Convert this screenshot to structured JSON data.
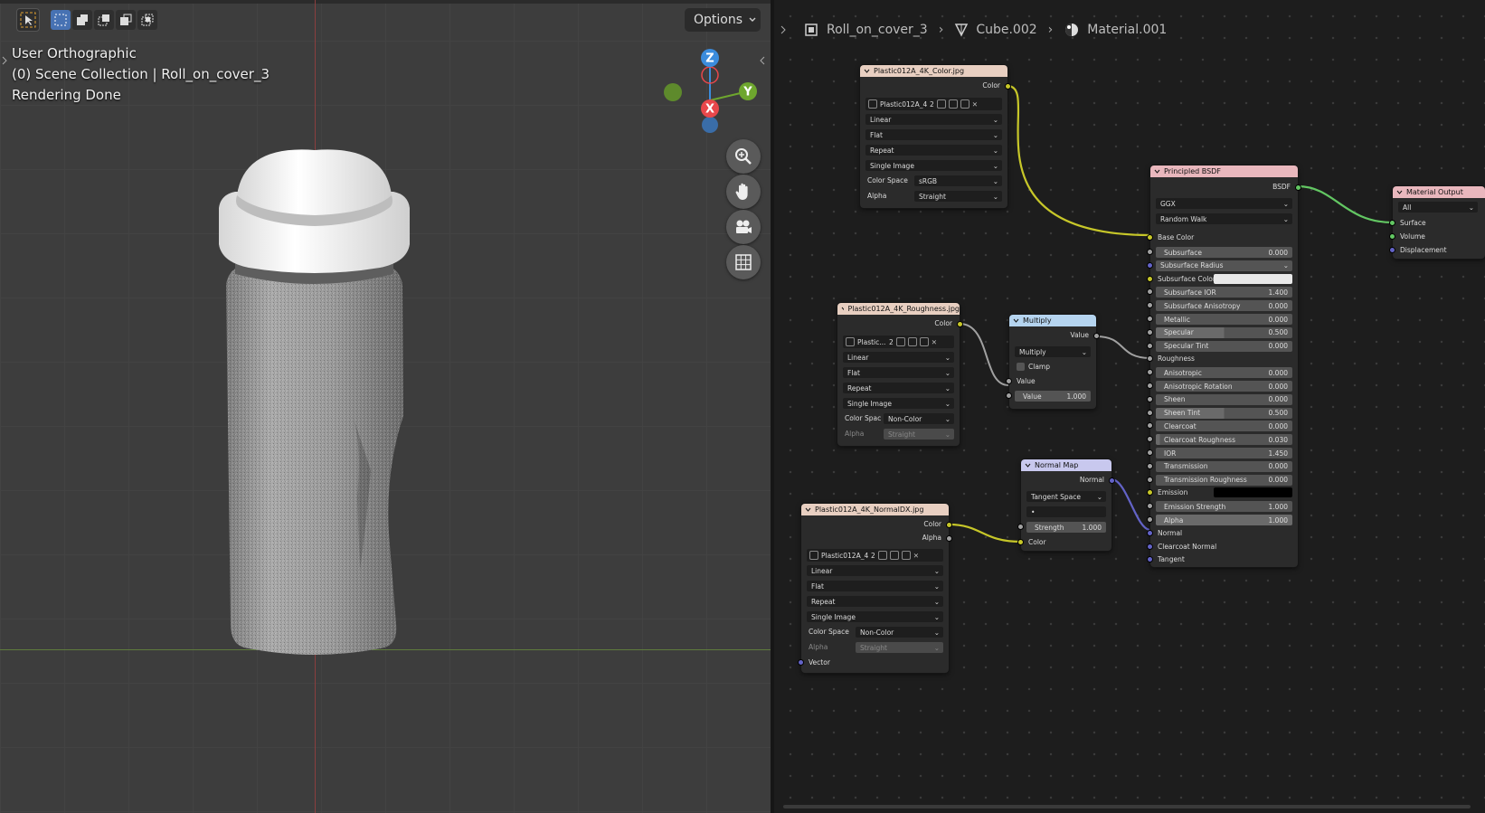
{
  "viewport": {
    "options_label": "Options",
    "overlay": {
      "view_name": "User Orthographic",
      "collection": "(0) Scene Collection | Roll_on_cover_3",
      "status": "Rendering Done"
    },
    "gizmo": {
      "z": "Z",
      "y": "Y",
      "x": "X"
    },
    "colors": {
      "bg": "#3d3d3d",
      "x_axis": "#e8474b",
      "y_axis": "#6ea62e",
      "z_axis": "#3b8cdc"
    }
  },
  "node_editor": {
    "breadcrumb": [
      "Roll_on_cover_3",
      "Cube.002",
      "Material.001"
    ],
    "nodes": {
      "color_tex": {
        "title": "Plastic012A_4K_Color.jpg",
        "output": "Color",
        "image_name": "Plastic012A_4...",
        "users": "2",
        "interpolation": "Linear",
        "projection": "Flat",
        "extension": "Repeat",
        "source": "Single Image",
        "colorspace_label": "Color Space",
        "colorspace": "sRGB",
        "alpha_label": "Alpha",
        "alpha": "Straight"
      },
      "rough_tex": {
        "title": "Plastic012A_4K_Roughness.jpg",
        "output": "Color",
        "image_name": "Plastic...",
        "users": "2",
        "interpolation": "Linear",
        "projection": "Flat",
        "extension": "Repeat",
        "source": "Single Image",
        "colorspace_label": "Color Spac",
        "colorspace": "Non-Color",
        "alpha_label": "Alpha",
        "alpha": "Straight"
      },
      "normal_tex": {
        "title": "Plastic012A_4K_NormalDX.jpg",
        "output_color": "Color",
        "output_alpha": "Alpha",
        "image_name": "Plastic012A_4...",
        "users": "2",
        "interpolation": "Linear",
        "projection": "Flat",
        "extension": "Repeat",
        "source": "Single Image",
        "colorspace_label": "Color Space",
        "colorspace": "Non-Color",
        "alpha_label": "Alpha",
        "alpha": "Straight",
        "vector_input": "Vector"
      },
      "multiply": {
        "title": "Multiply",
        "output": "Value",
        "operation": "Multiply",
        "clamp_label": "Clamp",
        "input1": "Value",
        "input2_label": "Value",
        "input2_value": "1.000"
      },
      "normal_map": {
        "title": "Normal Map",
        "output": "Normal",
        "space": "Tangent Space",
        "uv": "•",
        "strength_label": "Strength",
        "strength_value": "1.000",
        "color_input": "Color"
      },
      "bsdf": {
        "title": "Principled BSDF",
        "output": "BSDF",
        "distribution": "GGX",
        "subsurface_method": "Random Walk",
        "base_color": "Base Color",
        "fields": [
          {
            "label": "Subsurface",
            "value": "0.000",
            "fill": 0
          },
          {
            "label": "Subsurface Radius",
            "value": "",
            "fill": 0,
            "dropdown": true
          },
          {
            "label": "Subsurface Color",
            "value": "",
            "fill": 0,
            "color": true
          },
          {
            "label": "Subsurface IOR",
            "value": "1.400",
            "fill": 0
          },
          {
            "label": "Subsurface Anisotropy",
            "value": "0.000",
            "fill": 0
          },
          {
            "label": "Metallic",
            "value": "0.000",
            "fill": 0
          },
          {
            "label": "Specular",
            "value": "0.500",
            "fill": 0.5
          },
          {
            "label": "Specular Tint",
            "value": "0.000",
            "fill": 0
          },
          {
            "label": "Roughness",
            "value": "",
            "fill": 0,
            "socket_only": true
          },
          {
            "label": "Anisotropic",
            "value": "0.000",
            "fill": 0
          },
          {
            "label": "Anisotropic Rotation",
            "value": "0.000",
            "fill": 0
          },
          {
            "label": "Sheen",
            "value": "0.000",
            "fill": 0
          },
          {
            "label": "Sheen Tint",
            "value": "0.500",
            "fill": 0.5
          },
          {
            "label": "Clearcoat",
            "value": "0.000",
            "fill": 0
          },
          {
            "label": "Clearcoat Roughness",
            "value": "0.030",
            "fill": 0.03
          },
          {
            "label": "IOR",
            "value": "1.450",
            "fill": 0
          },
          {
            "label": "Transmission",
            "value": "0.000",
            "fill": 0
          },
          {
            "label": "Transmission Roughness",
            "value": "0.000",
            "fill": 0
          },
          {
            "label": "Emission",
            "value": "",
            "fill": 0,
            "black": true
          },
          {
            "label": "Emission Strength",
            "value": "1.000",
            "fill": 0
          },
          {
            "label": "Alpha",
            "value": "1.000",
            "fill": 1
          },
          {
            "label": "Normal",
            "value": "",
            "fill": 0,
            "socket_only": true
          },
          {
            "label": "Clearcoat Normal",
            "value": "",
            "fill": 0,
            "socket_only": true
          },
          {
            "label": "Tangent",
            "value": "",
            "fill": 0,
            "socket_only": true
          }
        ]
      },
      "output": {
        "title": "Material Output",
        "target": "All",
        "inputs": [
          "Surface",
          "Volume",
          "Displacement"
        ]
      }
    }
  }
}
